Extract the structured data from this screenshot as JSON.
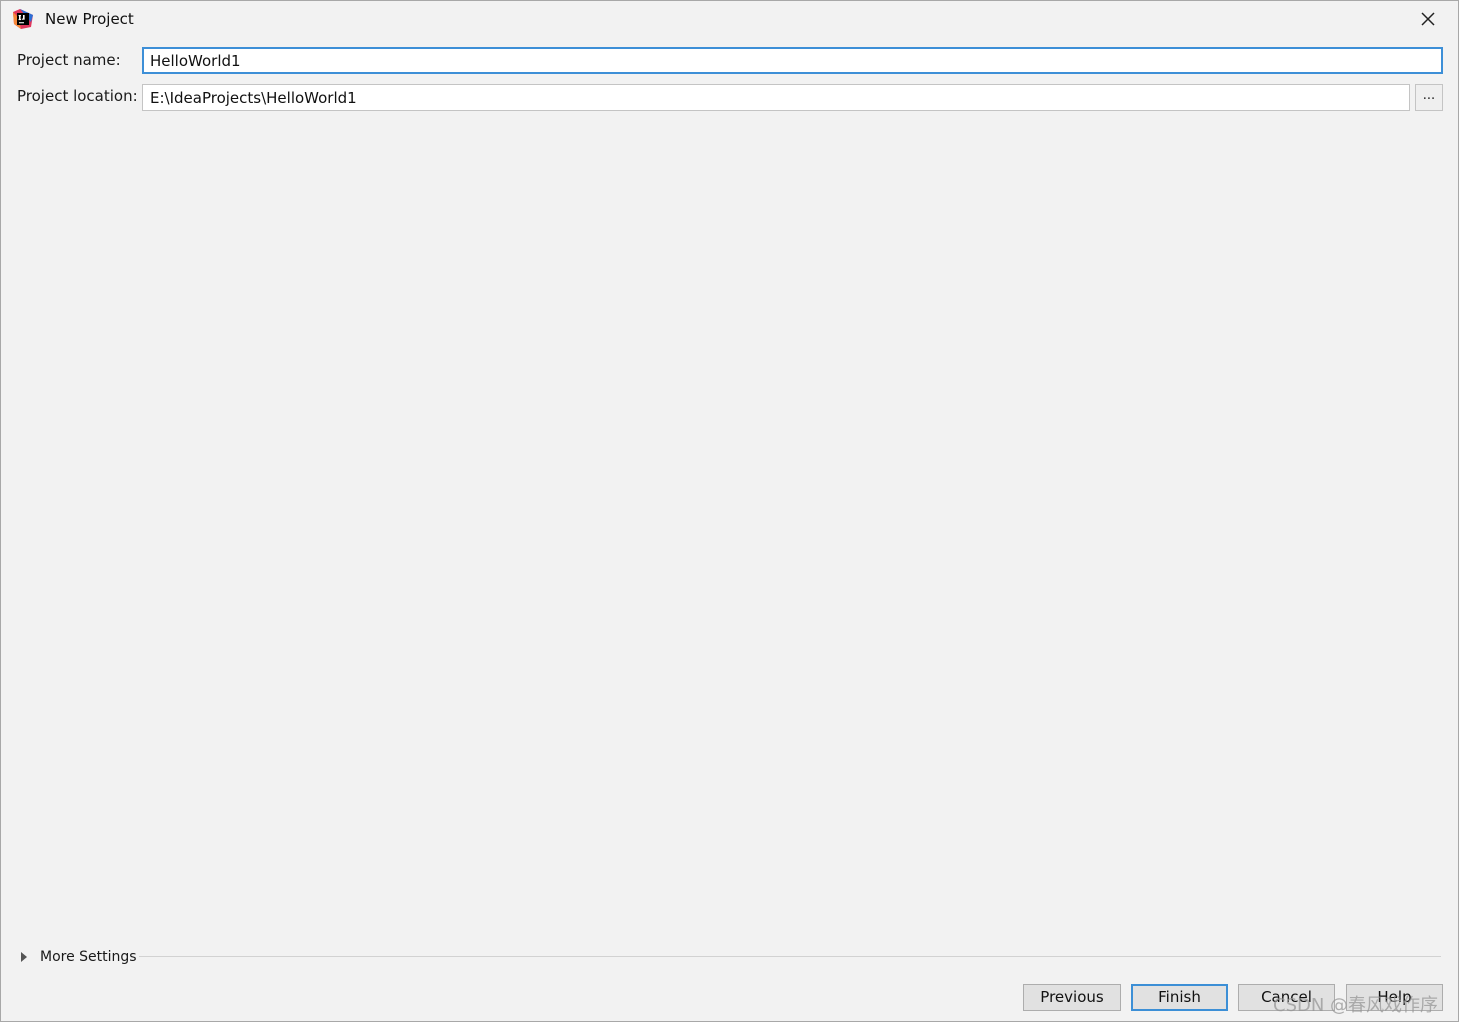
{
  "window": {
    "title": "New Project"
  },
  "form": {
    "project_name_label": "Project name:",
    "project_name_value": "HelloWorld1",
    "project_location_label": "Project location:",
    "project_location_value": "E:\\IdeaProjects\\HelloWorld1",
    "browse_label": "..."
  },
  "more_settings": {
    "label": "More Settings"
  },
  "buttons": {
    "previous": "Previous",
    "finish": "Finish",
    "cancel": "Cancel",
    "help": "Help"
  },
  "watermark": "CSDN @春风戏作序",
  "icons": {
    "app": "intellij-idea-icon",
    "close": "close-icon",
    "expand": "triangle-right-icon"
  },
  "colors": {
    "focus_border": "#3d8fd7",
    "background": "#f2f2f2"
  }
}
